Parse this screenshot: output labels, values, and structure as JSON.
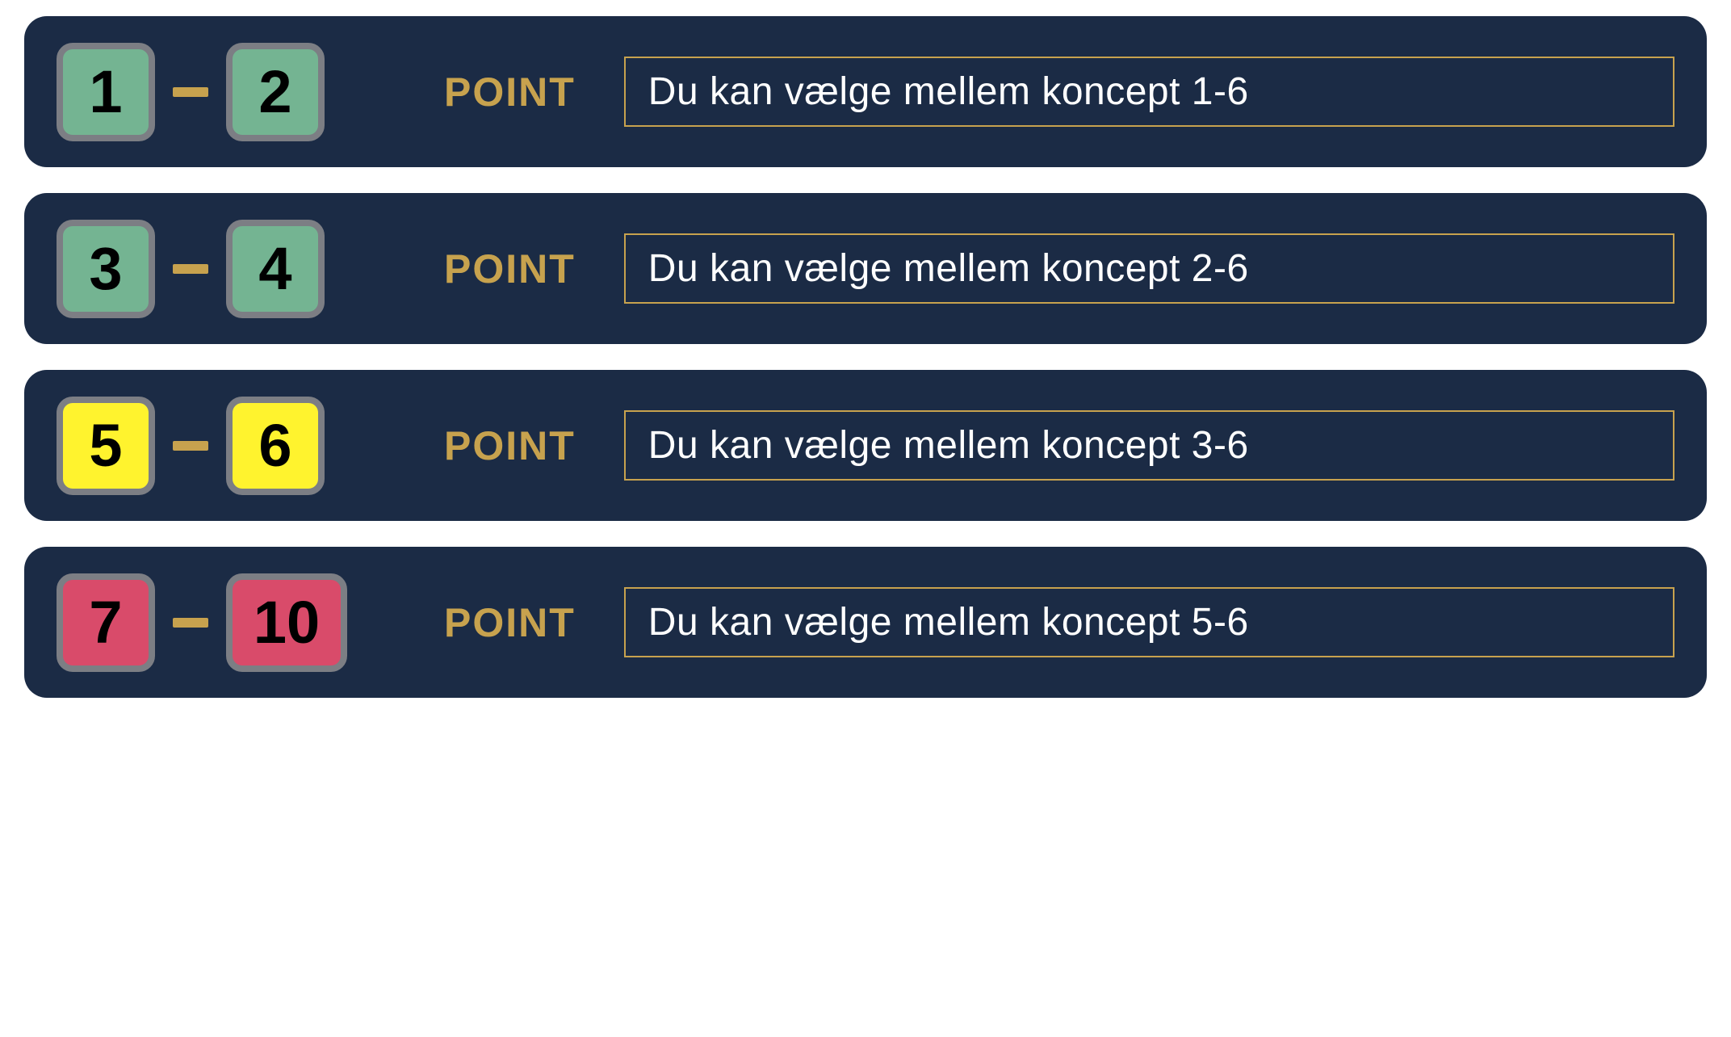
{
  "colors": {
    "panel_bg": "#1b2b45",
    "accent_gold": "#c7a24e",
    "tile_border": "#7c7e84",
    "tile_green": "#74b492",
    "tile_yellow": "#fff32e",
    "tile_red": "#d94b6a"
  },
  "point_label": "POINT",
  "rows": [
    {
      "range_from": "1",
      "range_to": "2",
      "tile_color": "green",
      "description": "Du kan vælge mellem koncept 1-6"
    },
    {
      "range_from": "3",
      "range_to": "4",
      "tile_color": "green",
      "description": "Du kan vælge mellem koncept 2-6"
    },
    {
      "range_from": "5",
      "range_to": "6",
      "tile_color": "yellow",
      "description": "Du kan vælge mellem koncept 3-6"
    },
    {
      "range_from": "7",
      "range_to": "10",
      "tile_color": "red",
      "description": "Du kan vælge mellem koncept 5-6"
    }
  ]
}
